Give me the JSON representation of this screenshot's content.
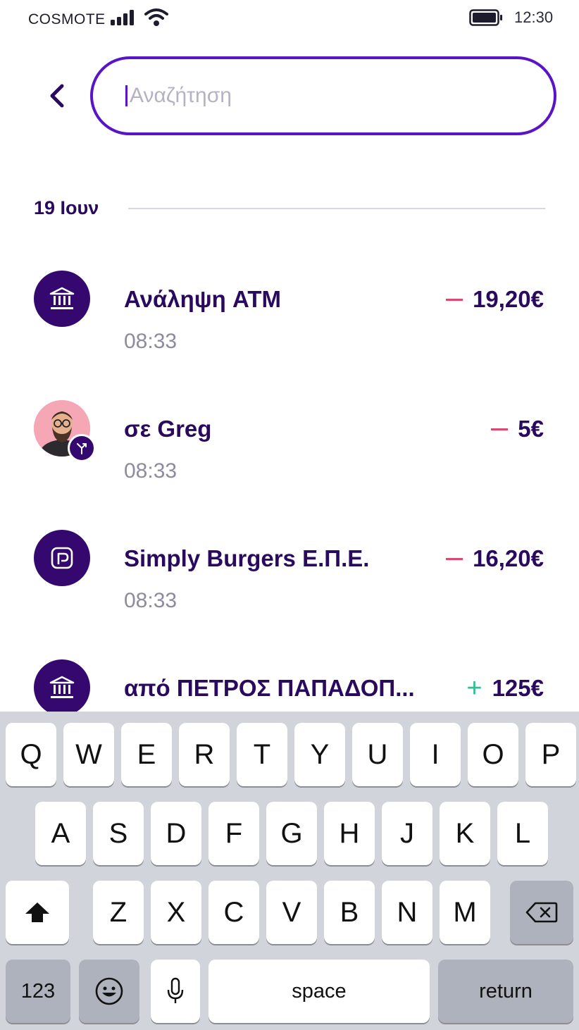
{
  "status_bar": {
    "carrier": "COSMOTE",
    "time": "12:30"
  },
  "search": {
    "placeholder": "Αναζήτηση",
    "value": ""
  },
  "date_header": "19 Ιουν",
  "transactions": [
    {
      "name": "Ανάληψη ATM",
      "time": "08:33",
      "sign": "minus",
      "amount": "19,20€",
      "icon": "bank-icon"
    },
    {
      "name": "σε Greg",
      "time": "08:33",
      "sign": "minus",
      "amount": "5€",
      "icon": "avatar-transfer"
    },
    {
      "name": "Simply Burgers Ε.Π.Ε.",
      "time": "08:33",
      "sign": "minus",
      "amount": "16,20€",
      "icon": "card-payment-icon"
    },
    {
      "name": "από ΠΕΤΡΟΣ ΠΑΠΑΔΟΠ...",
      "time": "",
      "sign": "plus",
      "amount": "125€",
      "icon": "bank-icon"
    }
  ],
  "keyboard": {
    "row1": [
      "Q",
      "W",
      "E",
      "R",
      "T",
      "Y",
      "U",
      "I",
      "O",
      "P"
    ],
    "row2": [
      "A",
      "S",
      "D",
      "F",
      "G",
      "H",
      "J",
      "K",
      "L"
    ],
    "row3": [
      "Z",
      "X",
      "C",
      "V",
      "B",
      "N",
      "M"
    ],
    "numbers_label": "123",
    "space_label": "space",
    "return_label": "return"
  },
  "colors": {
    "primary": "#35086f",
    "accent": "#5a14c8",
    "debit": "#e0476e",
    "credit": "#2cc093"
  }
}
